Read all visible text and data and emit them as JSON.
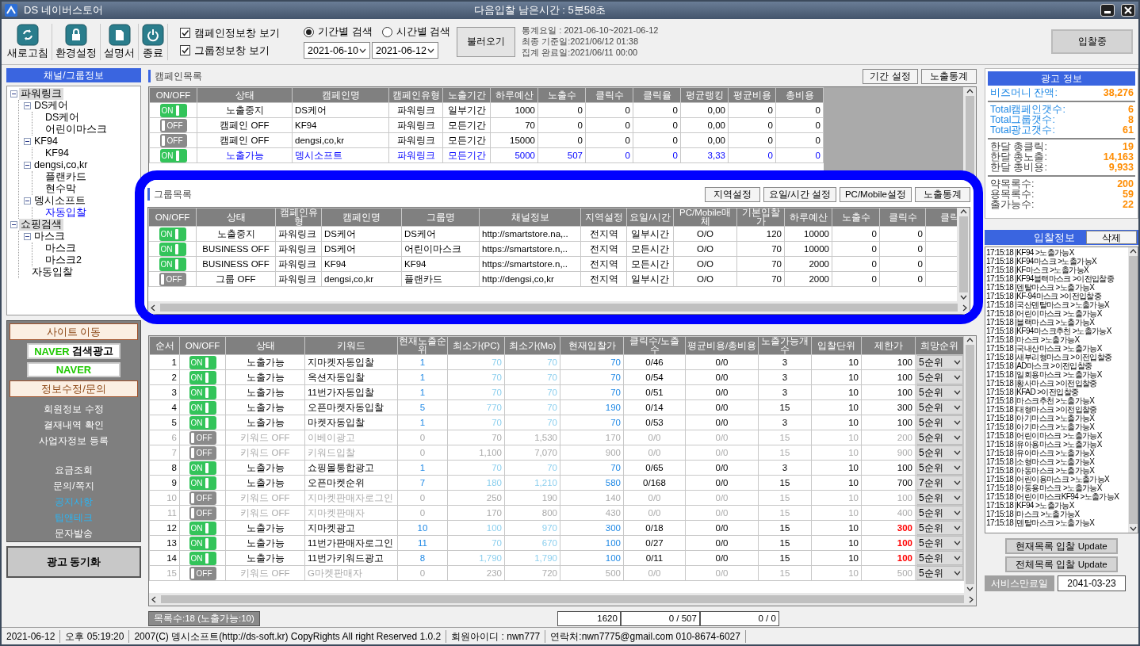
{
  "window": {
    "title": "DS 네이버스토어",
    "countdown": "다음입찰 남은시간 : 5분58초"
  },
  "toolbar": {
    "buttons": [
      {
        "label": "새로고침",
        "kind": "refresh"
      },
      {
        "label": "환경설정",
        "kind": "lock"
      },
      {
        "label": "설명서",
        "kind": "document"
      },
      {
        "label": "종료",
        "kind": "power"
      }
    ],
    "checkboxes": [
      {
        "label": "캠페인정보창 보기",
        "checked": true
      },
      {
        "label": "그룹정보창 보기",
        "checked": true
      }
    ],
    "search_modes": [
      {
        "label": "기간별 검색",
        "selected": true
      },
      {
        "label": "시간별 검색",
        "selected": false
      }
    ],
    "date_from": "2021-06-10",
    "date_to": "2021-06-12",
    "load_button": "불러오기",
    "stats_lines": [
      "통계요일 : 2021-06-10~2021-06-12",
      "최종 기준일:2021/06/12 01:38",
      "집계 완료일:2021/06/11 00:00"
    ],
    "status_button": "입찰중"
  },
  "sidebar": {
    "title": "채널/그룹정보",
    "tree": [
      {
        "label": "파워링크",
        "expanded": true,
        "selected": false,
        "children": [
          {
            "label": "DS케어",
            "expanded": true,
            "selected": false,
            "children": [
              {
                "label": "DS케어",
                "selected": false
              },
              {
                "label": "어린이마스크",
                "selected": false
              }
            ]
          },
          {
            "label": "KF94",
            "expanded": true,
            "selected": false,
            "children": [
              {
                "label": "KF94",
                "selected": false
              }
            ]
          },
          {
            "label": "dengsi,co,kr",
            "expanded": true,
            "selected": false,
            "children": [
              {
                "label": "플랜카드",
                "selected": false
              },
              {
                "label": "현수막",
                "selected": false
              }
            ]
          },
          {
            "label": "뎅시소프트",
            "expanded": true,
            "selected": false,
            "children": [
              {
                "label": "자동입찰",
                "selected": true
              }
            ]
          }
        ]
      },
      {
        "label": "쇼핑검색",
        "expanded": true,
        "selected": false,
        "children": [
          {
            "label": "마스크",
            "expanded": true,
            "selected": false,
            "children": [
              {
                "label": "마스크",
                "selected": false
              },
              {
                "label": "마스크2",
                "selected": false
              }
            ]
          },
          {
            "label": "자동입찰",
            "selected": false
          }
        ]
      }
    ],
    "site_title": "사이트 이동",
    "site_buttons": [
      {
        "brand": "NAVER",
        "label": "검색광고"
      },
      {
        "brand": "NAVER"
      }
    ],
    "info_title": "정보수정/문의",
    "link_groups": [
      [
        {
          "label": "회원정보 수정",
          "highlight": false
        },
        {
          "label": "결재내역 확인",
          "highlight": false
        },
        {
          "label": "사업자정보 등록",
          "highlight": false
        }
      ],
      [
        {
          "label": "요금조회",
          "highlight": false
        },
        {
          "label": "문의/쪽지",
          "highlight": false
        },
        {
          "label": "공지사항",
          "highlight": true
        },
        {
          "label": "팁앤테크",
          "highlight": true
        },
        {
          "label": "문자발송",
          "highlight": false
        }
      ]
    ],
    "sync_button": "광고 동기화"
  },
  "campaigns": {
    "title": "캠페인목록",
    "buttons": [
      "기간 설정",
      "노출통계"
    ],
    "columns": [
      "ON/OFF",
      "상태",
      "캠페인명",
      "캠페인유형",
      "노출기간",
      "하루예산",
      "노출수",
      "클릭수",
      "클릭율",
      "평균랭킹",
      "평균비용",
      "총비용"
    ],
    "rows": [
      {
        "on": true,
        "highlight": false,
        "cells": [
          "ON",
          "노출중지",
          "DS케어",
          "파워링크",
          "일부기간",
          "1000",
          "0",
          "0",
          "0",
          "0,00",
          "0",
          "0"
        ]
      },
      {
        "on": false,
        "highlight": false,
        "cells": [
          "OFF",
          "캠페인 OFF",
          "KF94",
          "파워링크",
          "모든기간",
          "70",
          "0",
          "0",
          "0",
          "0,00",
          "0",
          "0"
        ]
      },
      {
        "on": false,
        "highlight": false,
        "cells": [
          "OFF",
          "캠페인 OFF",
          "dengsi,co,kr",
          "파워링크",
          "모든기간",
          "15000",
          "0",
          "0",
          "0",
          "0,00",
          "0",
          "0"
        ]
      },
      {
        "on": true,
        "highlight": true,
        "cells": [
          "ON",
          "노출가능",
          "뎅시소프트",
          "파워링크",
          "모든기간",
          "5000",
          "507",
          "0",
          "0",
          "3,33",
          "0",
          "0"
        ]
      }
    ]
  },
  "groups": {
    "title": "그룹목록",
    "buttons": [
      "지역설정",
      "요일/시간 설정",
      "PC/Mobile설정",
      "노출통계"
    ],
    "columns": [
      "ON/OFF",
      "상태",
      "캠페인유형",
      "캠페인명",
      "그룹명",
      "채널정보",
      "지역설정",
      "요일/시간",
      "PC/Mobile매체",
      "기본입찰가",
      "하루예산",
      "노출수",
      "클릭수",
      "클릭"
    ],
    "rows": [
      {
        "on": true,
        "cells": [
          "ON",
          "노출중지",
          "파워링크",
          "DS케어",
          "DS케어",
          "http://smartstore.na,..",
          "전지역",
          "일부시간",
          "O/O",
          "120",
          "10000",
          "0",
          "0"
        ]
      },
      {
        "on": true,
        "cells": [
          "ON",
          "BUSINESS OFF",
          "파워링크",
          "DS케어",
          "어린이마스크",
          "https://smartstore.n,..",
          "전지역",
          "모든시간",
          "O/O",
          "70",
          "10000",
          "0",
          "0"
        ]
      },
      {
        "on": true,
        "cells": [
          "ON",
          "BUSINESS OFF",
          "파워링크",
          "KF94",
          "KF94",
          "https://smartstore.n,..",
          "전지역",
          "모든시간",
          "O/O",
          "70",
          "2000",
          "0",
          "0"
        ]
      },
      {
        "on": false,
        "cells": [
          "OFF",
          "그룹 OFF",
          "파워링크",
          "dengsi,co,kr",
          "플랜카드",
          "http://dengsi,co,kr",
          "전지역",
          "일부시간",
          "O/O",
          "70",
          "2000",
          "0",
          "0"
        ]
      }
    ]
  },
  "keywords": {
    "columns": [
      "순서",
      "ON/OFF",
      "상태",
      "키워드",
      "현재노출순위",
      "최소가(PC)",
      "최소가(Mo)",
      "현재입찰가",
      "클릭수/노출수",
      "평균비용/총비용",
      "노출가능개수",
      "입찰단위",
      "제한가",
      "희망순위"
    ],
    "rows": [
      {
        "on": true,
        "limit_alert": false,
        "cells": [
          "1",
          "ON",
          "노출가능",
          "지마켓자동입찰",
          "1",
          "70",
          "70",
          "70",
          "0/46",
          "0/0",
          "3",
          "10",
          "100",
          "5순위"
        ]
      },
      {
        "on": true,
        "limit_alert": false,
        "cells": [
          "2",
          "ON",
          "노출가능",
          "옥션자동입찰",
          "1",
          "70",
          "70",
          "70",
          "0/54",
          "0/0",
          "3",
          "10",
          "100",
          "5순위"
        ]
      },
      {
        "on": true,
        "limit_alert": false,
        "cells": [
          "3",
          "ON",
          "노출가능",
          "11번가자동입찰",
          "1",
          "70",
          "70",
          "70",
          "0/51",
          "0/0",
          "3",
          "10",
          "100",
          "5순위"
        ]
      },
      {
        "on": true,
        "limit_alert": false,
        "cells": [
          "4",
          "ON",
          "노출가능",
          "오픈마켓자동입찰",
          "5",
          "770",
          "70",
          "190",
          "0/14",
          "0/0",
          "15",
          "10",
          "300",
          "5순위"
        ]
      },
      {
        "on": true,
        "limit_alert": false,
        "cells": [
          "5",
          "ON",
          "노출가능",
          "마켓자동입찰",
          "1",
          "70",
          "70",
          "70",
          "0/53",
          "0/0",
          "3",
          "10",
          "100",
          "5순위"
        ]
      },
      {
        "on": false,
        "limit_alert": false,
        "cells": [
          "6",
          "OFF",
          "키워드 OFF",
          "이베이광고",
          "0",
          "70",
          "1,530",
          "170",
          "0/0",
          "0/0",
          "15",
          "10",
          "200",
          "5순위"
        ]
      },
      {
        "on": false,
        "limit_alert": false,
        "cells": [
          "7",
          "OFF",
          "키워드 OFF",
          "키워드입찰",
          "0",
          "1,100",
          "7,070",
          "900",
          "0/0",
          "0/0",
          "15",
          "10",
          "900",
          "5순위"
        ]
      },
      {
        "on": true,
        "limit_alert": false,
        "cells": [
          "8",
          "ON",
          "노출가능",
          "쇼핑몰통합광고",
          "1",
          "70",
          "70",
          "70",
          "0/65",
          "0/0",
          "3",
          "10",
          "100",
          "5순위"
        ]
      },
      {
        "on": true,
        "limit_alert": false,
        "cells": [
          "9",
          "ON",
          "노출가능",
          "오픈마켓순위",
          "7",
          "180",
          "1,210",
          "580",
          "0/168",
          "0/0",
          "15",
          "10",
          "700",
          "7순위"
        ]
      },
      {
        "on": false,
        "limit_alert": false,
        "cells": [
          "10",
          "OFF",
          "키워드 OFF",
          "지마켓판매자로그인",
          "0",
          "250",
          "190",
          "140",
          "0/0",
          "0/0",
          "15",
          "10",
          "100",
          "5순위"
        ]
      },
      {
        "on": false,
        "limit_alert": false,
        "cells": [
          "11",
          "OFF",
          "키워드 OFF",
          "지마켓판매자",
          "0",
          "170",
          "800",
          "430",
          "0/0",
          "0/0",
          "15",
          "10",
          "400",
          "5순위"
        ]
      },
      {
        "on": true,
        "limit_alert": true,
        "cells": [
          "12",
          "ON",
          "노출가능",
          "지마켓광고",
          "10",
          "100",
          "970",
          "300",
          "0/18",
          "0/0",
          "15",
          "10",
          "300",
          "5순위"
        ]
      },
      {
        "on": true,
        "limit_alert": true,
        "cells": [
          "13",
          "ON",
          "노출가능",
          "11번가판매자로그인",
          "11",
          "70",
          "670",
          "100",
          "0/27",
          "0/0",
          "15",
          "10",
          "100",
          "5순위"
        ]
      },
      {
        "on": true,
        "limit_alert": true,
        "cells": [
          "14",
          "ON",
          "노출가능",
          "11번가키워드광고",
          "8",
          "1,790",
          "1,790",
          "100",
          "0/11",
          "0/0",
          "15",
          "10",
          "100",
          "5순위"
        ]
      },
      {
        "on": false,
        "limit_alert": false,
        "cells": [
          "15",
          "OFF",
          "키워드 OFF",
          "G마켓판매자",
          "0",
          "230",
          "720",
          "500",
          "0/0",
          "0/0",
          "15",
          "10",
          "500",
          "5순위"
        ]
      }
    ]
  },
  "summary": {
    "count": "목록수:18 (노출가능:10)",
    "totals": [
      "1620",
      "0 / 507",
      "0 / 0"
    ]
  },
  "ad_info": {
    "title": "광고 정보",
    "groups": [
      {
        "kind": "accent",
        "items": [
          {
            "label": "비즈머니 잔액:",
            "value": "38,276"
          }
        ]
      },
      {
        "kind": "accent",
        "items": [
          {
            "label": "Total캠페인갯수:",
            "value": "6"
          },
          {
            "label": "Total그룹갯수:",
            "value": "8"
          },
          {
            "label": "Total광고갯수:",
            "value": "61"
          }
        ]
      },
      {
        "kind": "plain",
        "items": [
          {
            "label": "한달 총클릭:",
            "value": "19"
          },
          {
            "label": "한달 총노출:",
            "value": "14,163"
          },
          {
            "label": "한달 총비용:",
            "value": "9,933"
          }
        ]
      },
      {
        "kind": "plain",
        "items": [
          {
            "label": "약목록수:",
            "value": "200"
          },
          {
            "label": "용목록수:",
            "value": "59"
          },
          {
            "label": "출가능수:",
            "value": "22"
          }
        ]
      }
    ]
  },
  "bid_log": {
    "title": "입찰정보",
    "delete_button": "삭제",
    "entries": [
      "17:15:18 |KF94 >노출가능X",
      "17:15:18 |KF94마스크 >노출가능X",
      "17:15:18 |KF마스크 >노출가능X",
      "17:15:18 |KF94블랙마스크 >이전입찰중",
      "17:15:18 |덴탈마스크 >노출가능X",
      "17:15:18 |KF-94마스크 >이전입찰중",
      "17:15:18 |국산덴탈마스크 >노출가능X",
      "17:15:18 |어린이마스크 >노출가능X",
      "17:15:18 |블랙마스크 >노출가능X",
      "17:15:18 |KF94마스크추천 >노출가능X",
      "17:15:18 |마스크 >노출가능X",
      "17:15:18 |국내산마스크 >노출가능X",
      "17:15:18 |새부리형마스크 >이전입찰중",
      "17:15:18 |AD마스크 >이전입찰중",
      "17:15:18 |일회용마스크 >노출가능X",
      "17:15:18 |황사마스크 >이전입찰중",
      "17:15:18 |KFAD >이전입찰중",
      "17:15:18 |마스크추천 >노출가능X",
      "17:15:18 |대형마스크 >이전입찰중",
      "17:15:18 |아기마스크 >노출가능X",
      "17:15:18 |아기마스크 >노출가능X",
      "17:15:18 |어린이마스크 >노출가능X",
      "17:15:18 |유아용마스크 >노출가능X",
      "17:15:18 |유아마스크 >노출가능X",
      "17:15:18 |소형마스크 >노출가능X",
      "17:15:18 |아동마스크 >노출가능X",
      "17:15:18 |어린이용마스크 >노출가능X",
      "17:15:18 |아동용마스크 >노출가능X",
      "17:15:18 |어린이마스크KF94 >노출가능X",
      "17:15:18 |KF94 >노출가능X",
      "17:15:18 |마스크 >노출가능X",
      "17:15:18 |덴탈마스크 >노출가능X"
    ]
  },
  "update_buttons": [
    "현재목록 입찰 Update",
    "전체목록 입찰 Update"
  ],
  "expiry": {
    "label": "서비스만료일",
    "value": "2041-03-23"
  },
  "status_bar": [
    "2021-06-12",
    "오후 05:19:20",
    "2007(C) 뎅시소프트(http://ds-soft.kr) CopyRights All right Reserved 1.0.2",
    "회원아이디 : nwn777",
    "연락처:nwn7775@gmail.com 010-8674-6027"
  ]
}
